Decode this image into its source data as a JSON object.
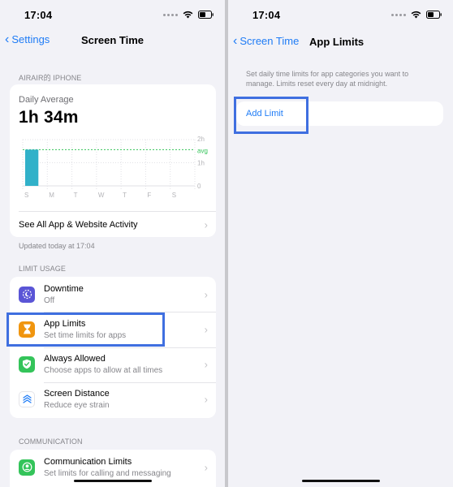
{
  "left": {
    "status_time": "17:04",
    "nav_back": "Settings",
    "nav_title": "Screen Time",
    "device_label": "AIRAIR的 iPHONE",
    "daily": {
      "label": "Daily Average",
      "value": "1h 34m",
      "y_ticks": [
        "2h",
        "avg",
        "1h",
        "0"
      ],
      "days": [
        "S",
        "M",
        "T",
        "W",
        "T",
        "F",
        "S"
      ],
      "bar_minutes": [
        94,
        0,
        0,
        0,
        0,
        0,
        0
      ],
      "max_minutes": 120,
      "avg_minutes": 94
    },
    "see_all": "See All App & Website Activity",
    "updated": "Updated today at 17:04",
    "limit_usage_label": "LIMIT USAGE",
    "limit_items": [
      {
        "title": "Downtime",
        "subtitle": "Off",
        "icon": "downtime-icon",
        "color": "#5a55d6"
      },
      {
        "title": "App Limits",
        "subtitle": "Set time limits for apps",
        "icon": "hourglass-icon",
        "color": "#f0950f"
      },
      {
        "title": "Always Allowed",
        "subtitle": "Choose apps to allow at all times",
        "icon": "checkmark-shield-icon",
        "color": "#34c45a"
      },
      {
        "title": "Screen Distance",
        "subtitle": "Reduce eye strain",
        "icon": "screen-distance-icon",
        "color": "#ffffff"
      }
    ],
    "communication_label": "COMMUNICATION",
    "communication_items": [
      {
        "title": "Communication Limits",
        "subtitle": "Set limits for calling and messaging",
        "icon": "person-circle-icon",
        "color": "#34c45a"
      }
    ]
  },
  "right": {
    "status_time": "17:04",
    "nav_back": "Screen Time",
    "nav_title": "App Limits",
    "description": "Set daily time limits for app categories you want to manage. Limits reset every day at midnight.",
    "add_limit": "Add Limit"
  },
  "colors": {
    "accent": "#1f7cf6",
    "highlight": "#3f6fe0",
    "bar": "#31b1c9",
    "avg_line": "#34c45a"
  }
}
